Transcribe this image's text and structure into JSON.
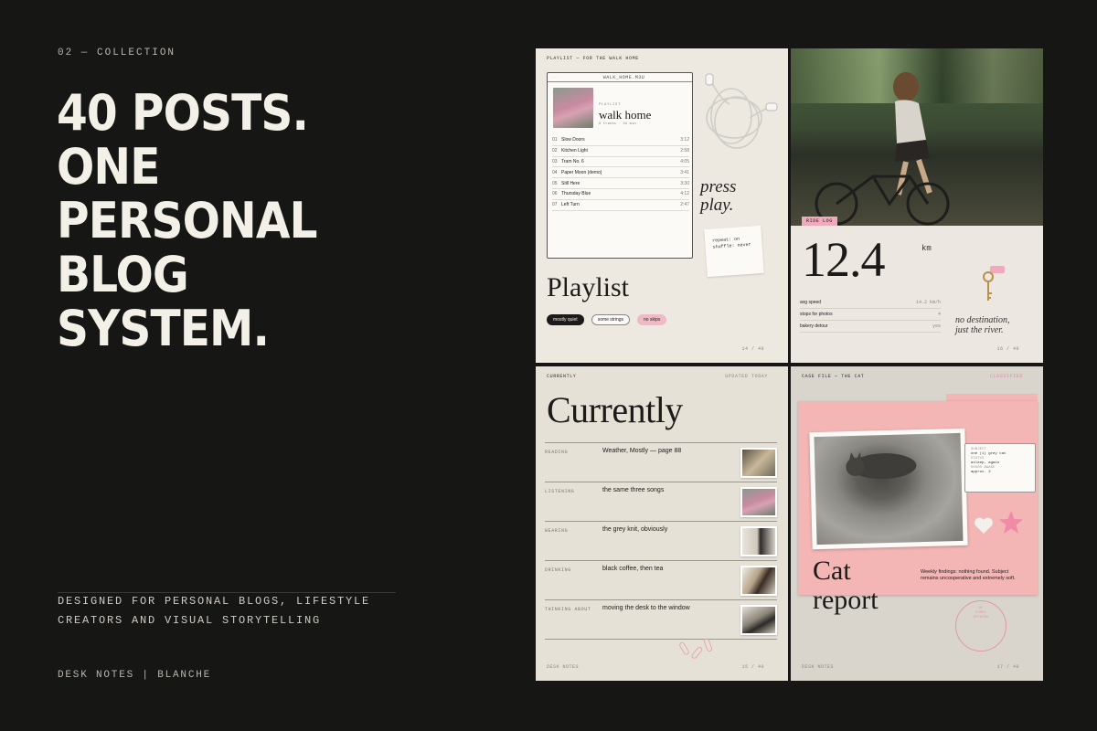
{
  "eyebrow": "02 — COLLECTION",
  "headline": [
    "40 POSTS.",
    "ONE",
    "PERSONAL",
    "BLOG",
    "SYSTEM."
  ],
  "tagline": [
    "DESIGNED FOR PERSONAL BLOGS, LIFESTYLE",
    "CREATORS AND VISUAL STORYTELLING"
  ],
  "brand": "DESK NOTES | BLANCHE",
  "colors": {
    "background": "#161615",
    "pink": "#f0a9bd",
    "cream": "#ede9e0"
  },
  "playlist_card": {
    "header": "PLAYLIST — FOR THE WALK HOME",
    "window_title": "WALK_HOME.M3U",
    "window_controls": "●●○",
    "label": "PLAYLIST",
    "title": "walk home",
    "subtitle": "8 tracks · 34 min",
    "tracks": [
      {
        "num": "01",
        "name": "Slow Doors",
        "dur": "3:12"
      },
      {
        "num": "02",
        "name": "Kitchen Light",
        "dur": "2:58"
      },
      {
        "num": "03",
        "name": "Tram No. 6",
        "dur": "4:05"
      },
      {
        "num": "04",
        "name": "Paper Moon (demo)",
        "dur": "3:41"
      },
      {
        "num": "05",
        "name": "Still Here",
        "dur": "3:30"
      },
      {
        "num": "06",
        "name": "Thursday Blue",
        "dur": "4:12"
      },
      {
        "num": "07",
        "name": "Left Turn",
        "dur": "2:47"
      }
    ],
    "handwriting": [
      "press",
      "play."
    ],
    "note": [
      "repeat: on",
      "shuffle: never"
    ],
    "big_title": "Playlist",
    "chips": [
      "mostly quiet",
      "some strings",
      "no skips"
    ],
    "page": "14 / 40"
  },
  "ride_card": {
    "tag": "RIDE LOG",
    "distance": "12.4",
    "unit": "km",
    "stats": [
      {
        "label": "avg speed",
        "value": "14.2 km/h"
      },
      {
        "label": "stops for photos",
        "value": "4"
      },
      {
        "label": "bakery detour",
        "value": "yes"
      }
    ],
    "caption": [
      "no destination,",
      "just the river."
    ],
    "page": "16 / 40"
  },
  "currently_card": {
    "header": "CURRENTLY",
    "header_right": "UPDATED TODAY",
    "title": "Currently",
    "rows": [
      {
        "key": "READING",
        "value": "Weather, Mostly — page 88"
      },
      {
        "key": "LISTENING",
        "value": "the same three songs"
      },
      {
        "key": "WEARING",
        "value": "the grey knit, obviously"
      },
      {
        "key": "DRINKING",
        "value": "black coffee, then tea"
      },
      {
        "key": "THINKING ABOUT",
        "value": "moving the desk to the window"
      }
    ],
    "footer": "DESK NOTES",
    "page": "15 / 40"
  },
  "cat_card": {
    "header": "CASE FILE — THE CAT",
    "header_right": "CLASSIFIED",
    "subject_label": "SUBJECT",
    "subject": "one (1) grey cat",
    "status_label": "STATUS",
    "status": "asleep, again",
    "naps_label": "HOURS AWAKE",
    "naps": "approx. 2",
    "title": [
      "Cat",
      "report"
    ],
    "weekly": "Weekly findings: nothing found. Subject remains uncooperative and extremely soft.",
    "stamp": [
      "OF",
      "FURRY",
      "AFFAIRS"
    ],
    "footer": "DESK NOTES",
    "page": "17 / 40"
  }
}
